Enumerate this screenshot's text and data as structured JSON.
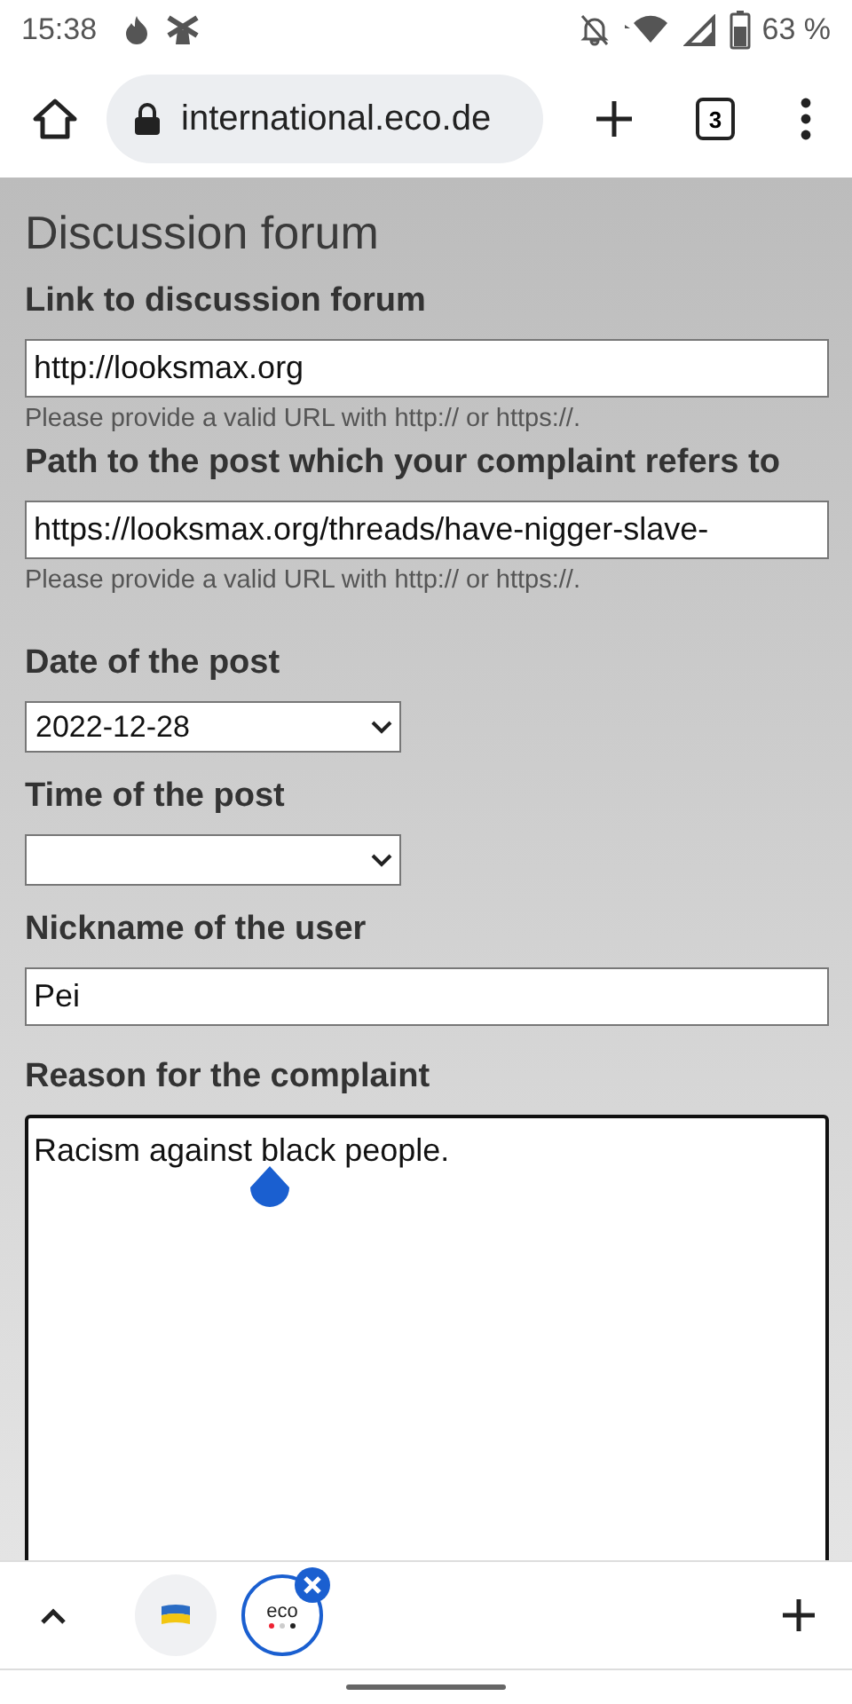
{
  "status_bar": {
    "time": "15:38",
    "battery": "63 %"
  },
  "browser_toolbar": {
    "address": "international.eco.de",
    "tab_count": "3"
  },
  "form": {
    "heading": "Discussion forum",
    "fields": [
      {
        "kind": "text",
        "label": "Link to discussion forum",
        "value": "http://looksmax.org",
        "hint": "Please provide a valid URL with http:// or https://."
      },
      {
        "kind": "text",
        "label": "Path to the post which your complaint refers to",
        "value": "https://looksmax.org/threads/have-nigger-slave-",
        "hint": "Please provide a valid URL with http:// or https://."
      },
      {
        "kind": "select",
        "label": "Date of the post",
        "value": "2022-12-28"
      },
      {
        "kind": "select",
        "label": "Time of the post"
      },
      {
        "kind": "text",
        "label": "Nickname of the user",
        "value": "Pei"
      },
      {
        "kind": "textarea",
        "label": "Reason for the complaint",
        "value": "Racism against black people."
      }
    ]
  },
  "tab_strip": {
    "tabs": [
      {
        "kind": "flag",
        "selected": false
      },
      {
        "kind": "logo",
        "label": "eco",
        "selected": true
      }
    ]
  }
}
